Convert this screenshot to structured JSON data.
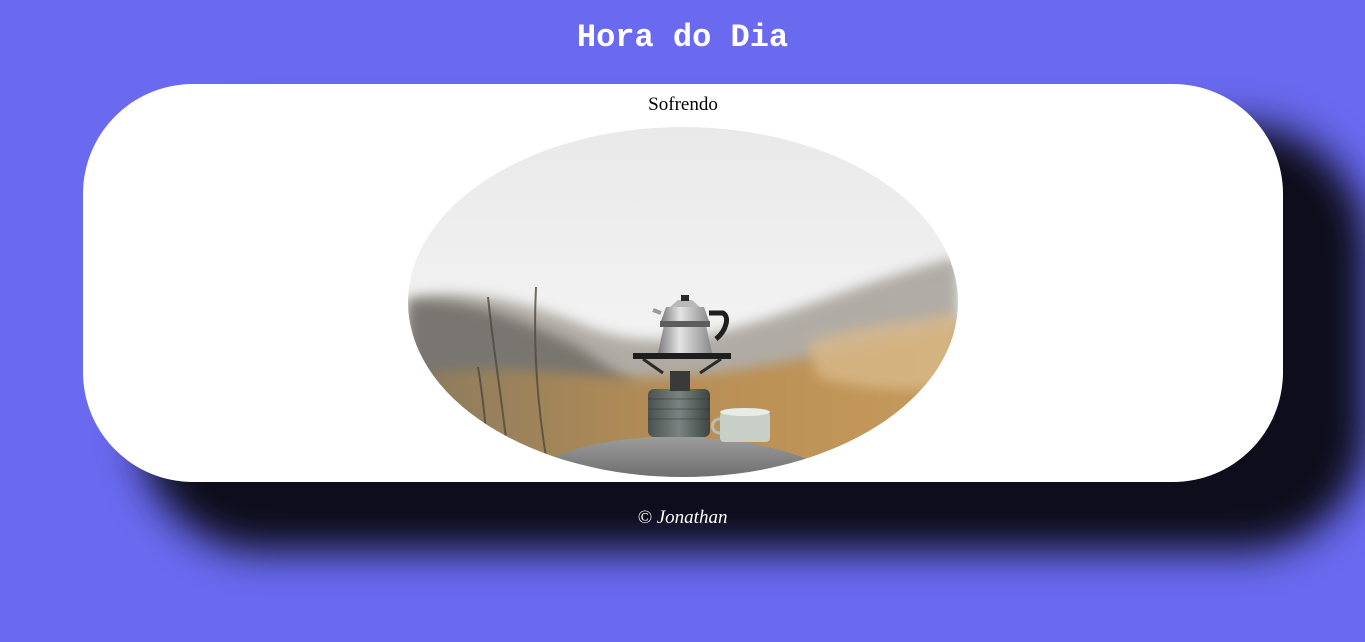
{
  "header": {
    "title": "Hora do Dia"
  },
  "card": {
    "caption": "Sofrendo",
    "image_subject": "moka-pot-on-camping-stove"
  },
  "footer": {
    "copyright": "© Jonathan"
  },
  "colors": {
    "background": "#6a6af1",
    "card": "#ffffff",
    "shadow": "#0a0a14"
  }
}
